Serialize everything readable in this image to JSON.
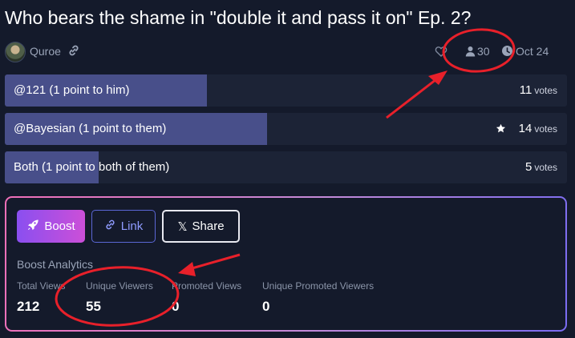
{
  "poll": {
    "title": "Who bears the shame in \"double it and pass it on\" Ep. 2?",
    "author": "Quroe",
    "participants": "30",
    "date": "Oct 24",
    "options": [
      {
        "label": "@121 (1 point to him)",
        "votes": "11",
        "votes_word": "votes",
        "share": 0.36
      },
      {
        "label": "@Bayesian (1 point to them)",
        "votes": "14",
        "votes_word": "votes",
        "share": 0.467
      },
      {
        "label": "Both (1 point to both of them)",
        "votes": "5",
        "votes_word": "votes",
        "share": 0.167
      }
    ]
  },
  "boost": {
    "boost_label": "Boost",
    "link_label": "Link",
    "share_label": "Share",
    "share_prefix": "𝕏",
    "analytics_title": "Boost Analytics",
    "stats": [
      {
        "label": "Total Views",
        "value": "212"
      },
      {
        "label": "Unique Viewers",
        "value": "55"
      },
      {
        "label": "Promoted Views",
        "value": "0"
      },
      {
        "label": "Unique Promoted Viewers",
        "value": "0"
      }
    ]
  },
  "colors": {
    "background": "#141a2b",
    "bar_fill": "#484f8a",
    "bar_track": "#1c2336",
    "annotation_red": "#e8202a",
    "boost_gradient": [
      "#8a4ff0",
      "#cc4fd8"
    ],
    "link_accent": "#8f9cff"
  },
  "icons": {
    "author_link": "link-icon",
    "like": "heart-icon",
    "participants": "user-icon",
    "date": "clock-icon",
    "winner": "star-icon",
    "boost": "rocket-icon",
    "link_button": "link-icon"
  }
}
